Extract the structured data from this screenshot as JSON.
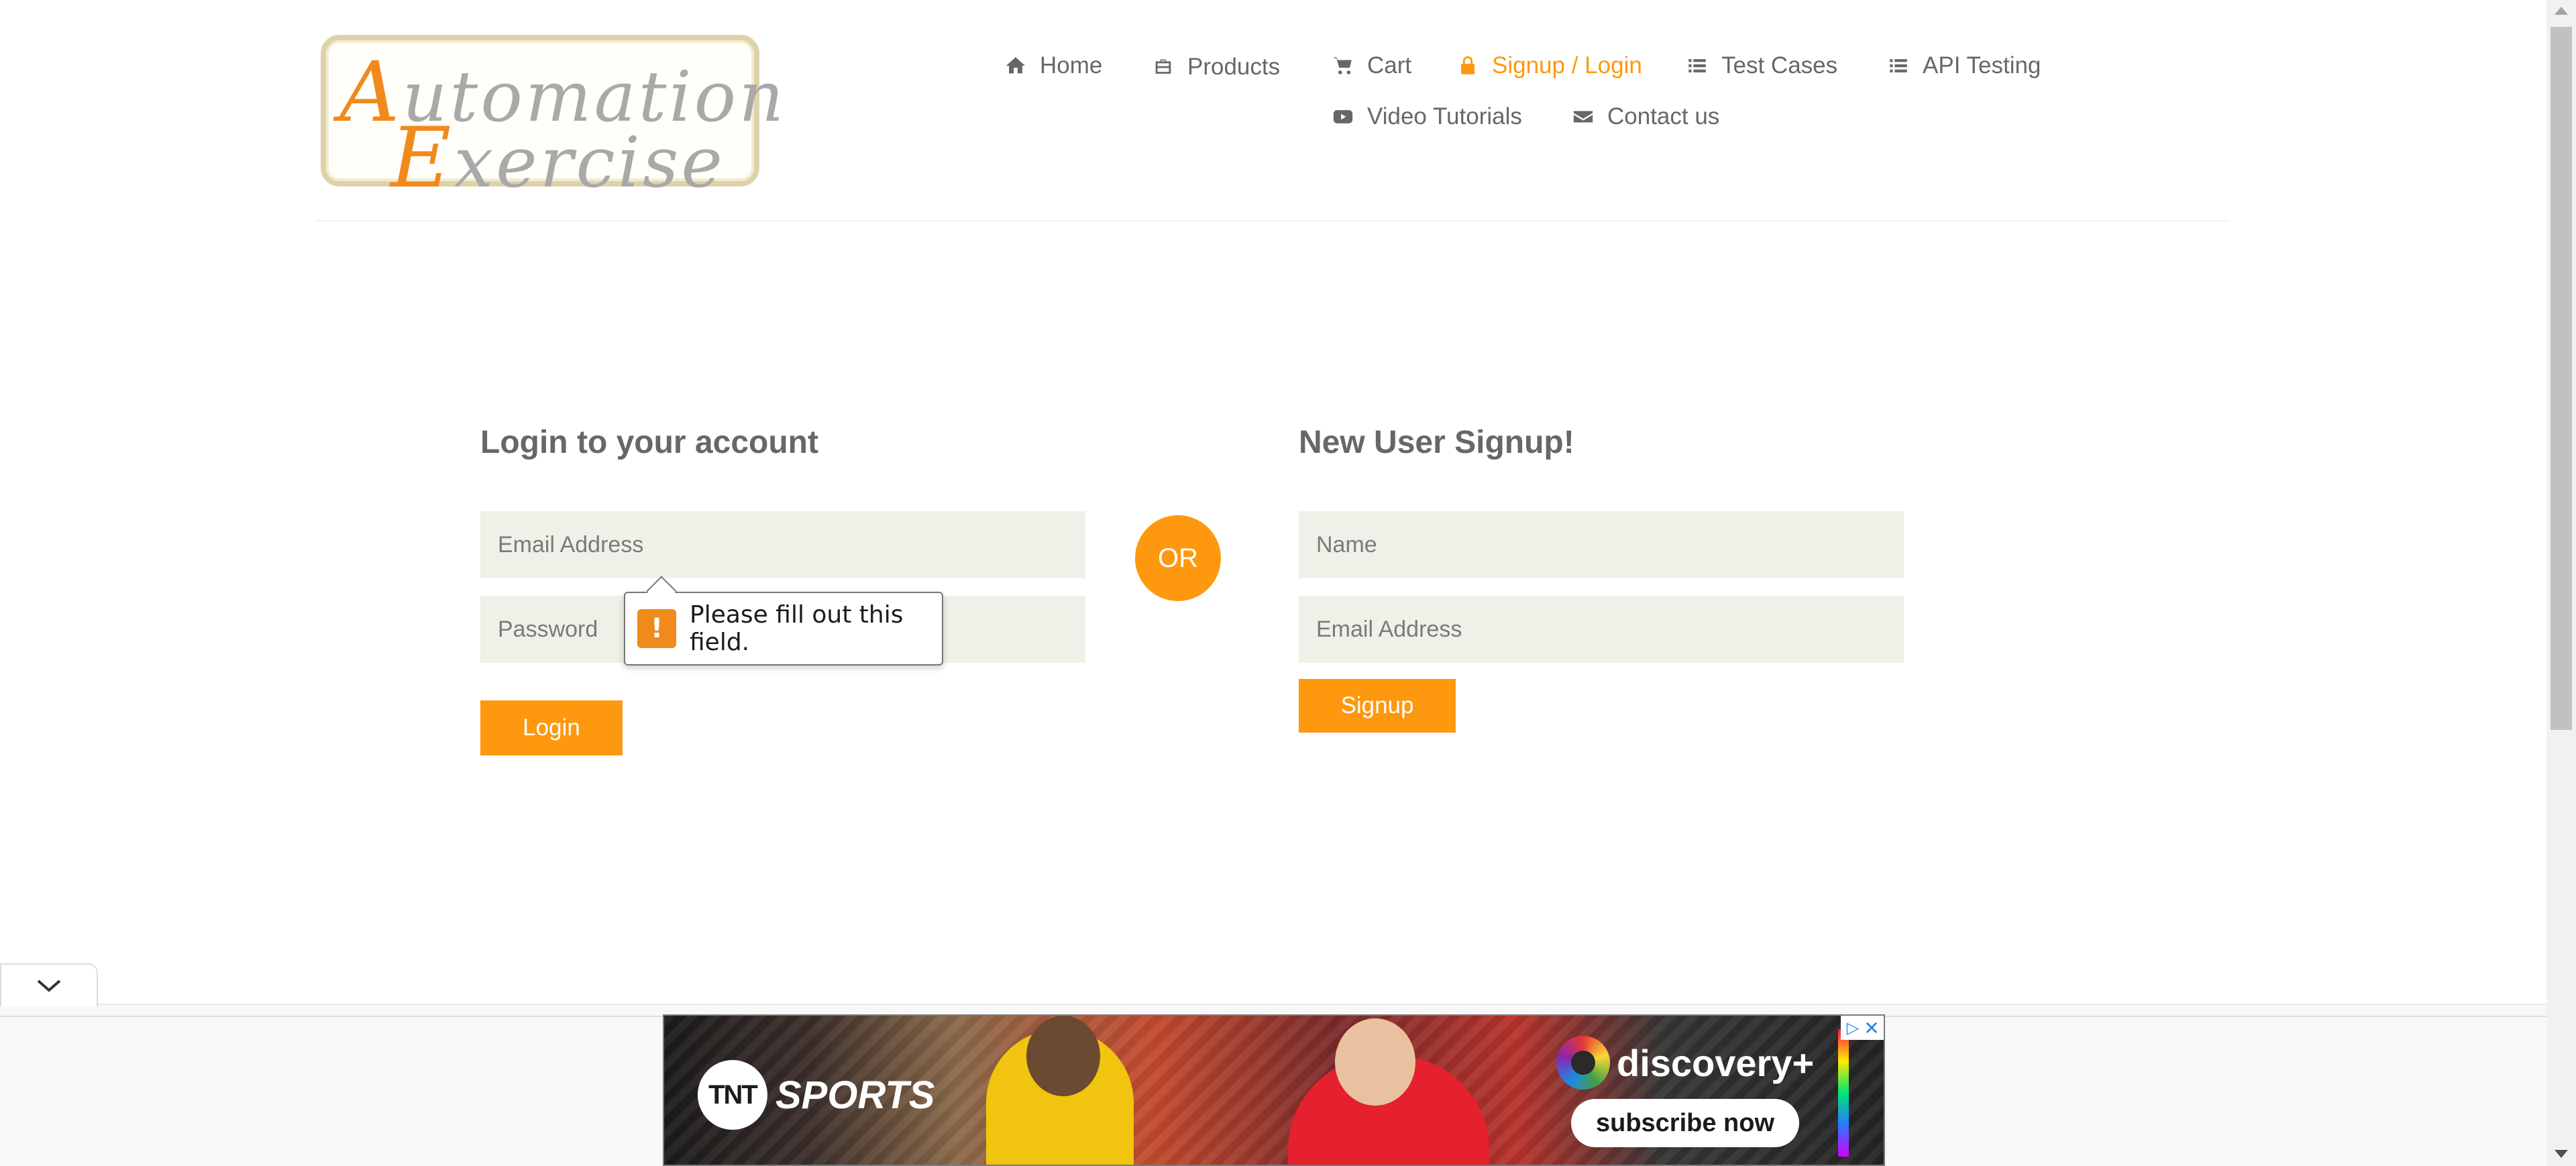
{
  "header": {
    "logo": {
      "line1_cap": "A",
      "line1_rest": "utomation",
      "line2_cap": "E",
      "line2_rest": "xercise"
    },
    "nav": [
      {
        "label": "Home",
        "icon": "home-icon"
      },
      {
        "label": "Products",
        "icon": "briefcase-icon"
      },
      {
        "label": "Cart",
        "icon": "cart-icon"
      },
      {
        "label": "Signup / Login",
        "icon": "lock-icon",
        "active": true
      },
      {
        "label": "Test Cases",
        "icon": "list-icon"
      },
      {
        "label": "API Testing",
        "icon": "list-icon"
      },
      {
        "label": "Video Tutorials",
        "icon": "youtube-play-icon"
      },
      {
        "label": "Contact us",
        "icon": "envelope-icon"
      }
    ]
  },
  "login": {
    "title": "Login to your account",
    "email_placeholder": "Email Address",
    "password_placeholder": "Password",
    "button": "Login"
  },
  "or_label": "OR",
  "signup": {
    "title": "New User Signup!",
    "name_placeholder": "Name",
    "email_placeholder": "Email Address",
    "button": "Signup"
  },
  "validation": {
    "message": "Please fill out this field.",
    "icon": "!"
  },
  "ad": {
    "brand_left": "SPORTS",
    "brand_left_badge": "TNT",
    "brand_right": "discovery+",
    "cta": "subscribe now"
  },
  "colors": {
    "accent": "#fe980f",
    "field_bg": "#f0f0e9",
    "text": "#696763"
  }
}
